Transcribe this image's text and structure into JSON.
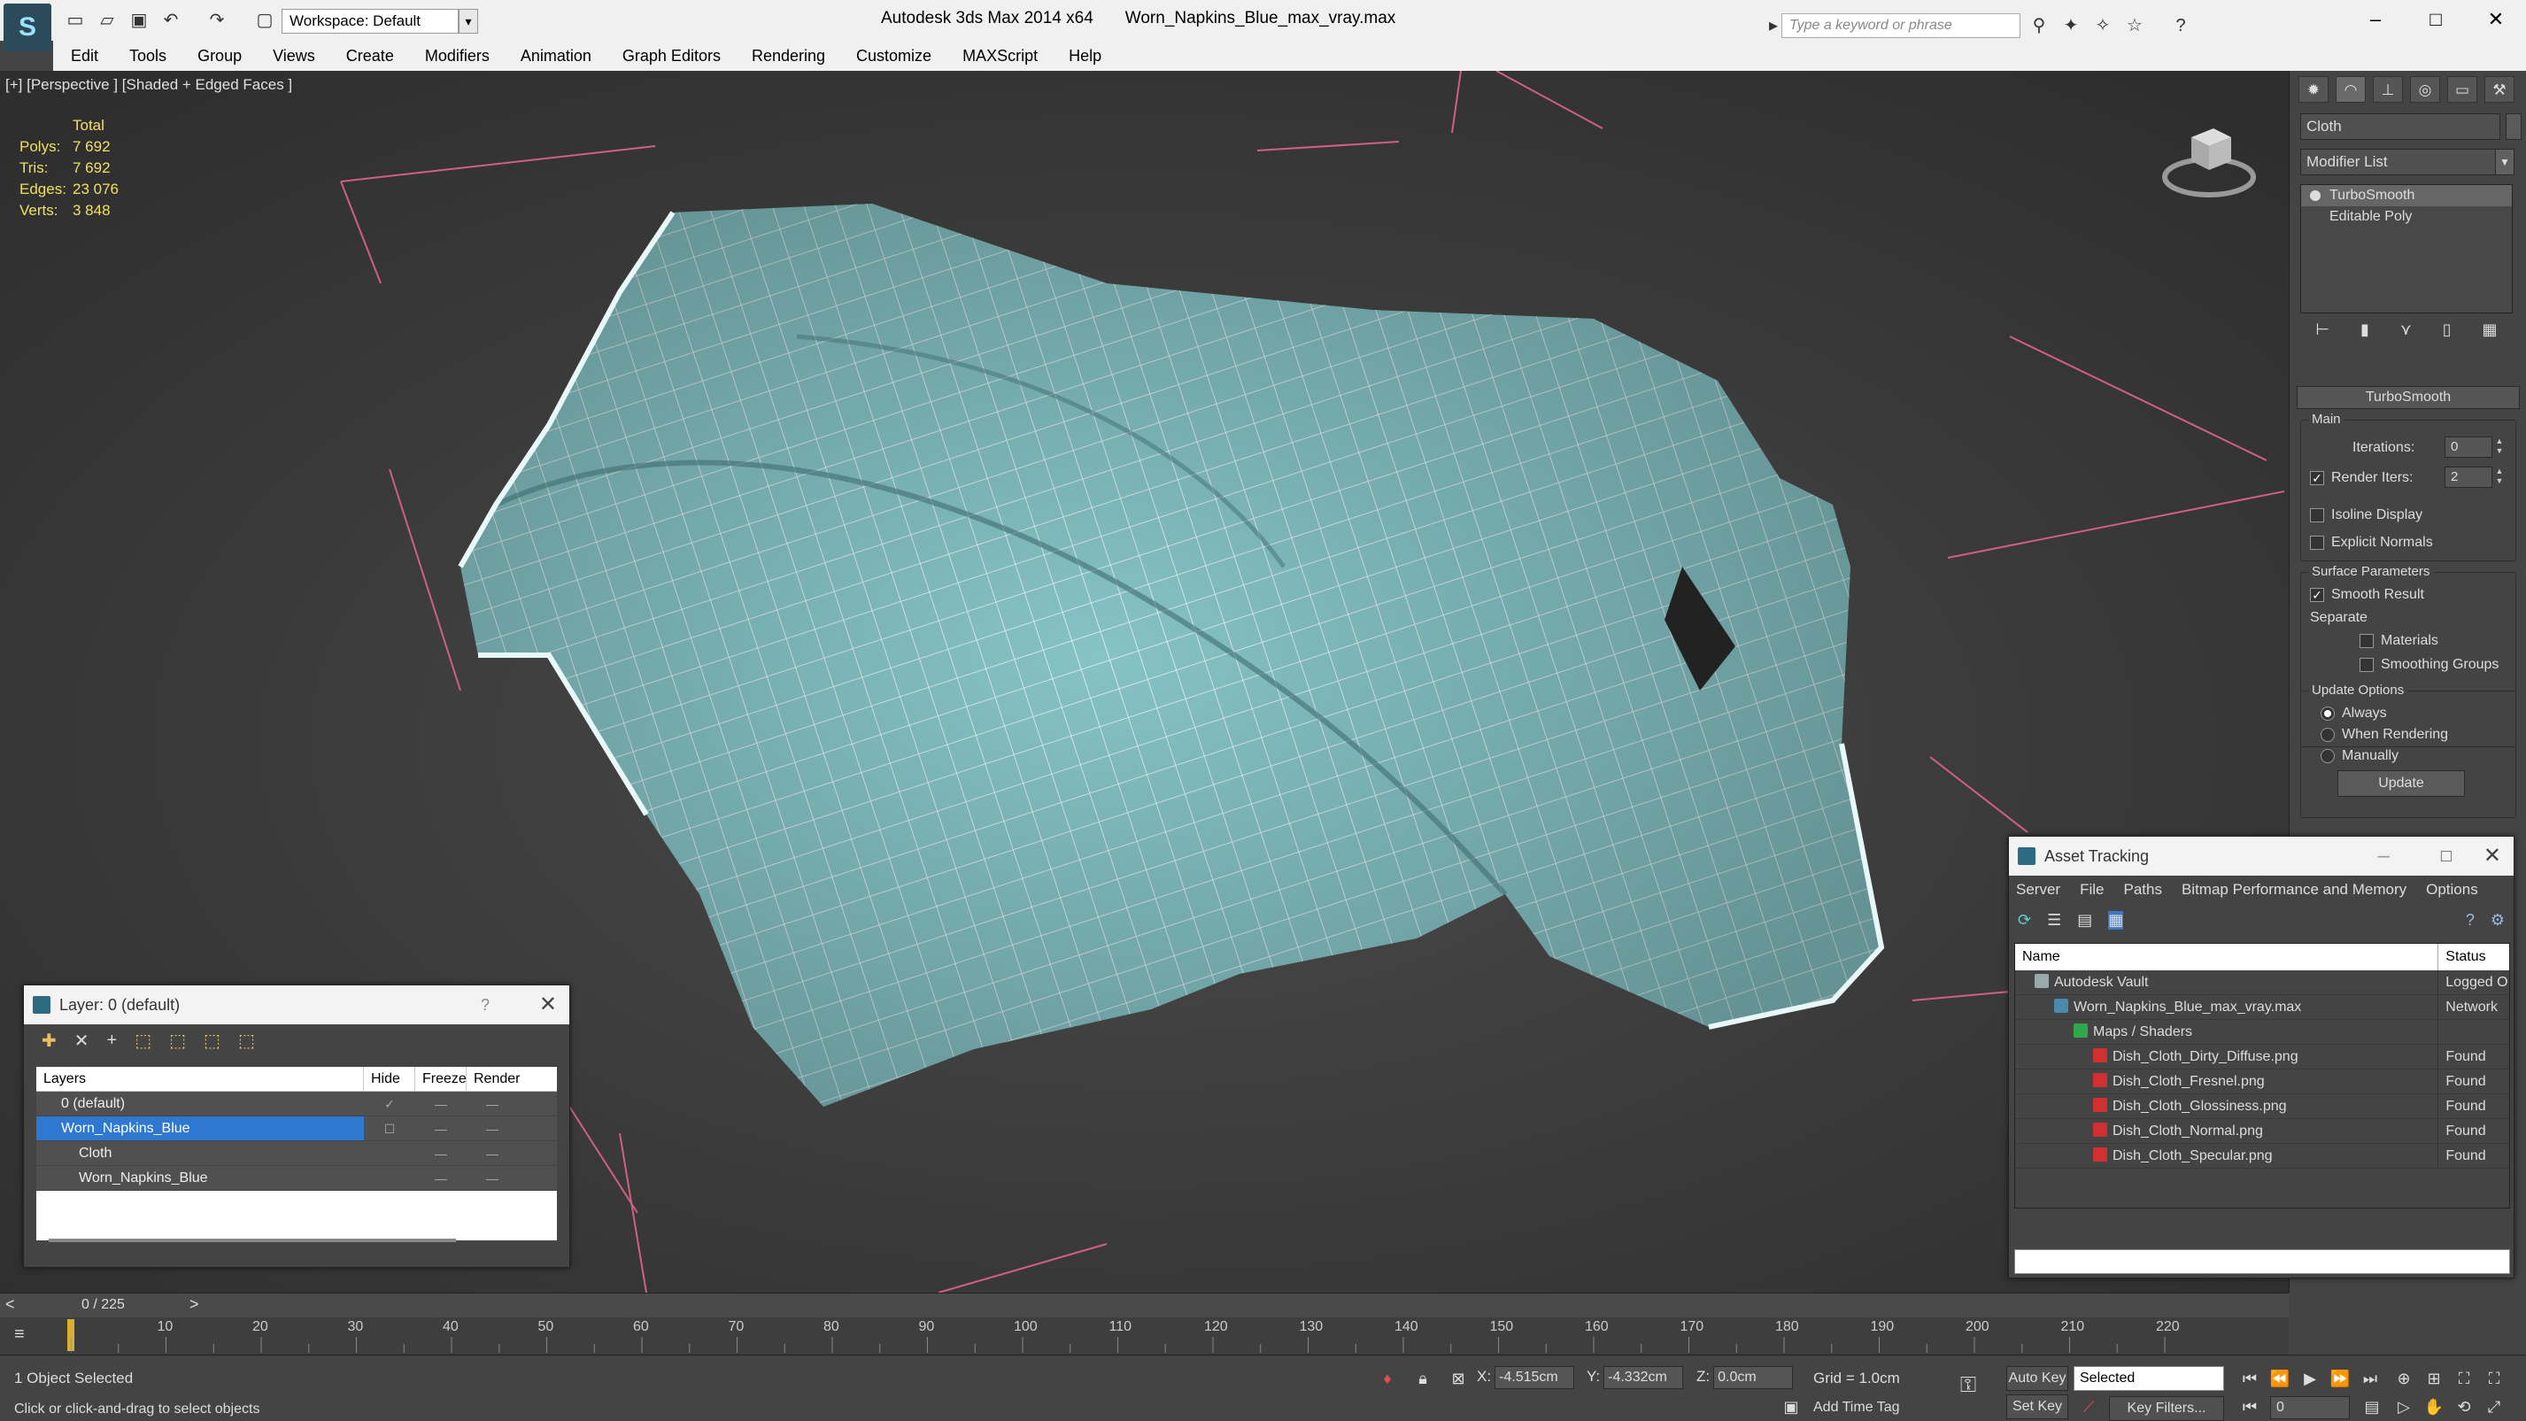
{
  "titlebar": {
    "app_name": "Autodesk 3ds Max  2014 x64",
    "file_name": "Worn_Napkins_Blue_max_vray.max",
    "workspace": "Workspace: Default",
    "search_placeholder": "Type a keyword or phrase"
  },
  "menu": [
    "Edit",
    "Tools",
    "Group",
    "Views",
    "Create",
    "Modifiers",
    "Animation",
    "Graph Editors",
    "Rendering",
    "Customize",
    "MAXScript",
    "Help"
  ],
  "viewport": {
    "label": "[+] [Perspective ] [Shaded + Edged Faces ]",
    "stats": {
      "header": "Total",
      "polys_label": "Polys:",
      "polys": "7 692",
      "tris_label": "Tris:",
      "tris": "7 692",
      "edges_label": "Edges:",
      "edges": "23 076",
      "verts_label": "Verts:",
      "verts": "3 848"
    },
    "cloth_color": "#86c3c6",
    "wire_color": "#ffffff"
  },
  "layer_panel": {
    "title": "Layer: 0 (default)",
    "help": "?",
    "columns": [
      "Layers",
      "Hide",
      "Freeze",
      "Render"
    ],
    "rows": [
      {
        "name": "0 (default)"
      },
      {
        "name": "Worn_Napkins_Blue"
      },
      {
        "name": "Cloth"
      },
      {
        "name": "Worn_Napkins_Blue"
      }
    ]
  },
  "command_panel": {
    "object_name": "Cloth",
    "modifier_list": "Modifier List",
    "stack": [
      "TurboSmooth",
      "Editable Poly"
    ],
    "rollout_title": "TurboSmooth",
    "main_group": "Main",
    "iterations_label": "Iterations:",
    "iterations": "0",
    "render_iters_label": "Render Iters:",
    "render_iters": "2",
    "isoline_display": "Isoline Display",
    "explicit_normals": "Explicit Normals",
    "surface_params": "Surface Parameters",
    "smooth_result": "Smooth Result",
    "separate": "Separate",
    "materials": "Materials",
    "smoothing_groups": "Smoothing Groups",
    "update_options": "Update Options",
    "always": "Always",
    "when_rendering": "When Rendering",
    "manually": "Manually",
    "update_button": "Update"
  },
  "asset_tracking": {
    "title": "Asset Tracking",
    "menu": [
      "Server",
      "File",
      "Paths",
      "Bitmap Performance and Memory",
      "Options"
    ],
    "columns": [
      "Name",
      "Status"
    ],
    "rows": [
      {
        "name": "Autodesk Vault",
        "status": "Logged O",
        "icon": "vault",
        "indent": 1
      },
      {
        "name": "Worn_Napkins_Blue_max_vray.max",
        "status": "Network",
        "icon": "max",
        "indent": 2
      },
      {
        "name": "Maps / Shaders",
        "status": "",
        "icon": "maps",
        "indent": 3
      },
      {
        "name": "Dish_Cloth_Dirty_Diffuse.png",
        "status": "Found",
        "icon": "png",
        "indent": 4
      },
      {
        "name": "Dish_Cloth_Fresnel.png",
        "status": "Found",
        "icon": "png",
        "indent": 4
      },
      {
        "name": "Dish_Cloth_Glossiness.png",
        "status": "Found",
        "icon": "png",
        "indent": 4
      },
      {
        "name": "Dish_Cloth_Normal.png",
        "status": "Found",
        "icon": "png",
        "indent": 4
      },
      {
        "name": "Dish_Cloth_Specular.png",
        "status": "Found",
        "icon": "png",
        "indent": 4
      }
    ]
  },
  "timeline": {
    "frame": "0 / 225",
    "ticks": [
      "10",
      "20",
      "30",
      "40",
      "50",
      "60",
      "70",
      "80",
      "90",
      "100",
      "110",
      "120",
      "130",
      "140",
      "150",
      "160",
      "170",
      "180",
      "190",
      "200",
      "210",
      "220"
    ]
  },
  "status": {
    "selection": "1 Object Selected",
    "prompt": "Click or click-and-drag to select objects",
    "x_label": "X:",
    "x": "-4.515cm",
    "y_label": "Y:",
    "y": "-4.332cm",
    "z_label": "Z:",
    "z": "0.0cm",
    "grid": "Grid = 1.0cm",
    "add_time_tag": "Add Time Tag",
    "auto_key": "Auto Key",
    "set_key": "Set Key",
    "key_mode": "Selected",
    "key_filters": "Key Filters...",
    "current_frame": "0"
  }
}
